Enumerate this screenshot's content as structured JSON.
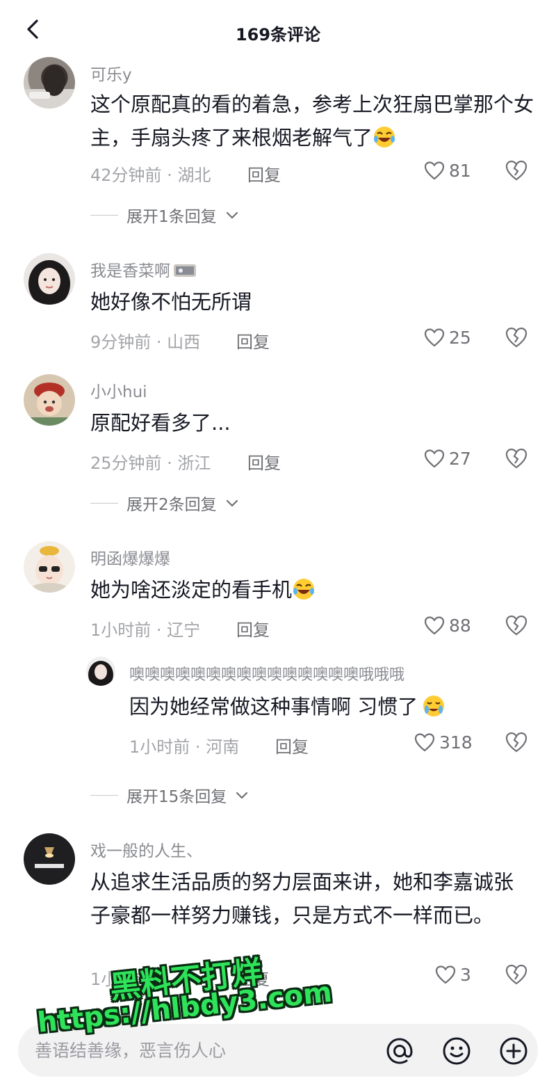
{
  "header": {
    "title": "169条评论"
  },
  "comments": [
    {
      "username": "可乐y",
      "content": "这个原配真的看的着急，参考上次狂扇巴掌那个女主，手扇头疼了来根烟老解气了",
      "time": "42分钟前",
      "location": "湖北",
      "reply_label": "回复",
      "likes": "81",
      "expand_label": "展开1条回复"
    },
    {
      "username": "我是香菜啊",
      "content": "她好像不怕无所谓",
      "time": "9分钟前",
      "location": "山西",
      "reply_label": "回复",
      "likes": "25"
    },
    {
      "username": "小小hui",
      "content": "原配好看多了...",
      "time": "25分钟前",
      "location": "浙江",
      "reply_label": "回复",
      "likes": "27",
      "expand_label": "展开2条回复"
    },
    {
      "username": "明函爆爆爆",
      "content": "她为啥还淡定的看手机",
      "time": "1小时前",
      "location": "辽宁",
      "reply_label": "回复",
      "likes": "88",
      "reply": {
        "username": "噢噢噢噢噢噢噢噢噢噢噢噢噢噢噢哦哦哦",
        "content": "因为她经常做这种事情啊 习惯了",
        "time": "1小时前",
        "location": "河南",
        "reply_label": "回复",
        "likes": "318"
      },
      "expand_label": "展开15条回复"
    },
    {
      "username": "戏一般的人生、",
      "content": "从追求生活品质的努力层面来讲，她和李嘉诚张子豪都一样努力赚钱，只是方式不一样而已。",
      "time": "1小时前",
      "reply_label": "回复",
      "likes": "3"
    }
  ],
  "watermark": {
    "line1": "黑料不打烊",
    "line2": "https://hlbdy3.com"
  },
  "input": {
    "placeholder": "善语结善缘，恶言伤人心"
  },
  "icons": {
    "back": "chevron-left-icon",
    "like": "heart-outline-icon",
    "dislike": "broken-heart-icon",
    "expand": "chevron-down-icon",
    "mention": "at-sign-icon",
    "emoji": "smiley-icon",
    "add": "plus-circle-icon"
  },
  "colors": {
    "watermark": "#2ee35a",
    "text": "#161823",
    "secondary": "#8a8b91"
  }
}
